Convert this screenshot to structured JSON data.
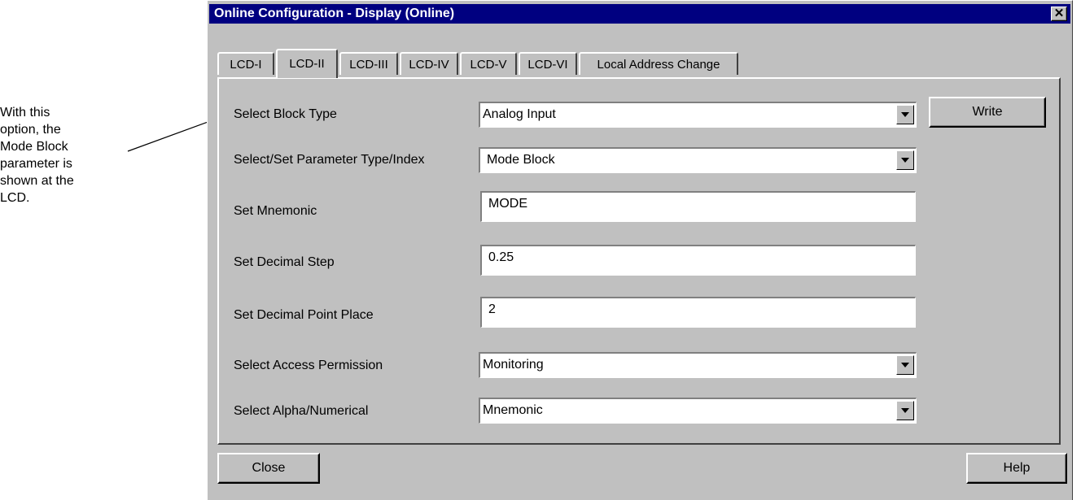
{
  "annotation": {
    "lines": [
      "With this",
      "option, the",
      "Mode Block",
      "parameter is",
      "shown at the",
      "LCD."
    ]
  },
  "window": {
    "title": "Online Configuration - Display  (Online)",
    "close_glyph": "✕"
  },
  "tabs": [
    {
      "label": "LCD-I",
      "active": false
    },
    {
      "label": "LCD-II",
      "active": true
    },
    {
      "label": "LCD-III",
      "active": false
    },
    {
      "label": "LCD-IV",
      "active": false
    },
    {
      "label": "LCD-V",
      "active": false
    },
    {
      "label": "LCD-VI",
      "active": false
    },
    {
      "label": "Local Address Change",
      "active": false
    }
  ],
  "form": {
    "block_type": {
      "label": "Select Block Type",
      "value": "Analog Input"
    },
    "parameter": {
      "label": "Select/Set Parameter Type/Index",
      "value": "Mode Block"
    },
    "mnemonic": {
      "label": "Set Mnemonic",
      "value": "MODE"
    },
    "decimal_step": {
      "label": "Set Decimal Step",
      "value": "0.25"
    },
    "decimal_point": {
      "label": "Set Decimal Point Place",
      "value": "2"
    },
    "access": {
      "label": "Select Access Permission",
      "value": "Monitoring"
    },
    "alpha": {
      "label": "Select Alpha/Numerical",
      "value": "Mnemonic"
    }
  },
  "buttons": {
    "write": "Write",
    "close": "Close",
    "help": "Help"
  },
  "icons": {
    "close": "close-icon",
    "dropdown": "chevron-down-icon"
  }
}
